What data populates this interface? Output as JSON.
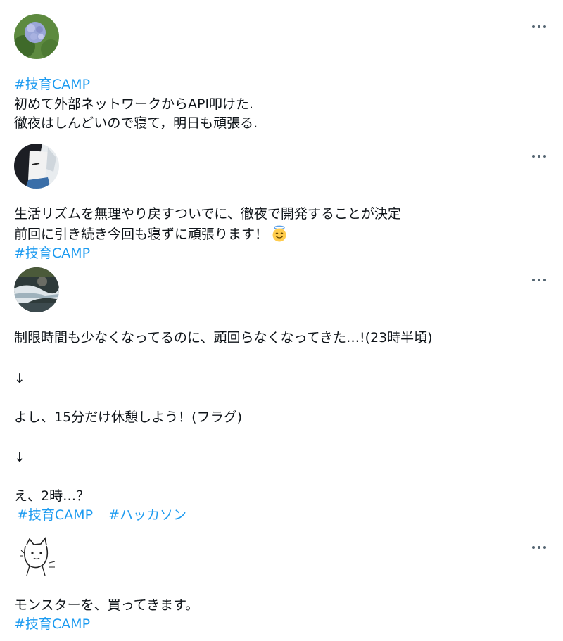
{
  "icons": {
    "more": "more-horizontal-icon",
    "emoji": "smiling-face-with-halo-emoji"
  },
  "colors": {
    "hashtag": "#1d9bf0",
    "text": "#0f1419",
    "more_icon": "#536471"
  },
  "posts": [
    {
      "avatar": "hydrangea-photo-avatar",
      "lines": [
        {
          "hashtag": "#技育CAMP"
        },
        {
          "text": "初めて外部ネットワークからAPI叩けた."
        },
        {
          "text": "徹夜はしんどいので寝て，明日も頑張る."
        }
      ]
    },
    {
      "avatar": "anime-character-avatar",
      "lines": [
        {
          "text": "生活リズムを無理やり戻すついでに、徹夜で開発することが決定"
        },
        {
          "text": "前回に引き続き今回も寝ずに頑張ります！"
        },
        {
          "hashtag": "#技育CAMP"
        }
      ]
    },
    {
      "avatar": "river-photo-avatar",
      "lines": [
        {
          "text": "制限時間も少なくなってるのに、頭回らなくなってきた…!(23時半頃)"
        },
        {
          "text": "↓"
        },
        {
          "text": "よし、15分だけ休憩しよう！(フラグ)"
        },
        {
          "text": "↓"
        },
        {
          "text": "え、2時…？"
        },
        {
          "hashtags": [
            "#技育CAMP",
            "#ハッカソン"
          ]
        }
      ]
    },
    {
      "avatar": "cat-sketch-avatar",
      "lines": [
        {
          "text": "モンスターを、買ってきます。"
        },
        {
          "hashtag": "#技育CAMP"
        }
      ]
    }
  ]
}
